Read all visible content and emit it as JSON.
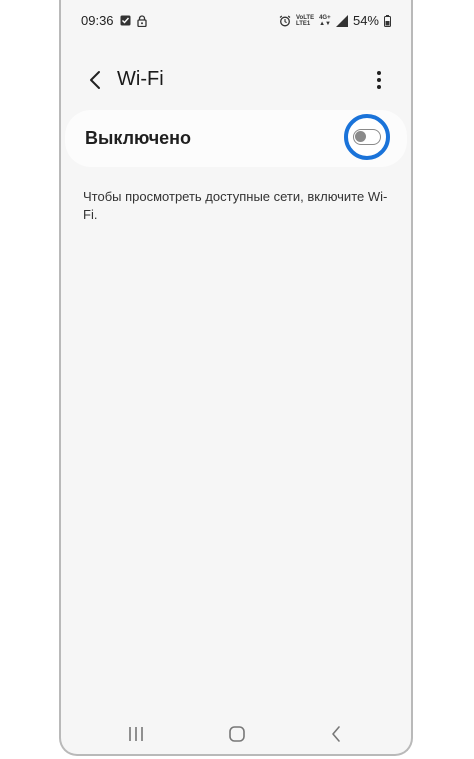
{
  "status_bar": {
    "time": "09:36",
    "network_top": "VoLTE",
    "network_bottom": "LTE1",
    "network_gen": "4G+",
    "battery_percent": "54%",
    "left_icons": [
      "gallery-icon",
      "lock-icon"
    ],
    "right_icons": [
      "alarm-icon",
      "signal-icon",
      "battery-icon"
    ]
  },
  "header": {
    "title": "Wi-Fi",
    "back_icon": "chevron-left-icon",
    "more_icon": "more-vertical-icon"
  },
  "wifi_toggle": {
    "label": "Выключено",
    "state": "off",
    "highlight_color": "#1a73d9"
  },
  "description": "Чтобы просмотреть доступные сети, включите Wi-Fi.",
  "nav_bar": {
    "icons": [
      "recents-icon",
      "home-icon",
      "back-icon"
    ]
  }
}
